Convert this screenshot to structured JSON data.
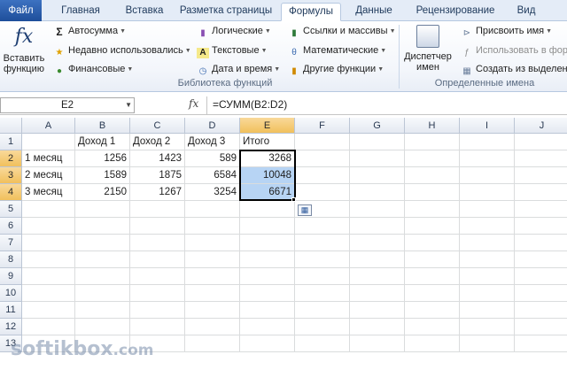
{
  "tabs": [
    {
      "label": "Файл"
    },
    {
      "label": "Главная"
    },
    {
      "label": "Вставка"
    },
    {
      "label": "Разметка страницы"
    },
    {
      "label": "Формулы"
    },
    {
      "label": "Данные"
    },
    {
      "label": "Рецензирование"
    },
    {
      "label": "Вид"
    }
  ],
  "ribbon": {
    "insert_function_line1": "Вставить",
    "insert_function_line2": "функцию",
    "autosum": "Автосумма",
    "recent": "Недавно использовались",
    "financial": "Финансовые",
    "logical": "Логические",
    "text": "Текстовые",
    "datetime": "Дата и время",
    "lookup": "Ссылки и массивы",
    "math": "Математические",
    "more": "Другие функции",
    "group_library": "Библиотека функций",
    "name_manager_line1": "Диспетчер",
    "name_manager_line2": "имен",
    "assign_name": "Присвоить имя",
    "use_in_formula": "Использовать в фор",
    "create_from_selection": "Создать из выделен",
    "group_names": "Определенные имена"
  },
  "formula_bar": {
    "name_box": "E2",
    "fx": "fx",
    "formula": "=СУММ(B2:D2)"
  },
  "columns": [
    "A",
    "B",
    "C",
    "D",
    "E",
    "F",
    "G",
    "H",
    "I",
    "J"
  ],
  "rows": [
    "1",
    "2",
    "3",
    "4",
    "5",
    "6",
    "7",
    "8",
    "9",
    "10",
    "11",
    "12",
    "13"
  ],
  "cells": {
    "B1": "Доход 1",
    "C1": "Доход 2",
    "D1": "Доход 3",
    "E1": "Итого",
    "A2": "1 месяц",
    "B2": "1256",
    "C2": "1423",
    "D2": "589",
    "E2": "3268",
    "A3": "2 месяц",
    "B3": "1589",
    "C3": "1875",
    "D3": "6584",
    "E3": "10048",
    "A4": "3 месяц",
    "B4": "2150",
    "C4": "1267",
    "D4": "3254",
    "E4": "6671"
  },
  "watermark": "softikbox",
  "watermark_tld": ".com"
}
